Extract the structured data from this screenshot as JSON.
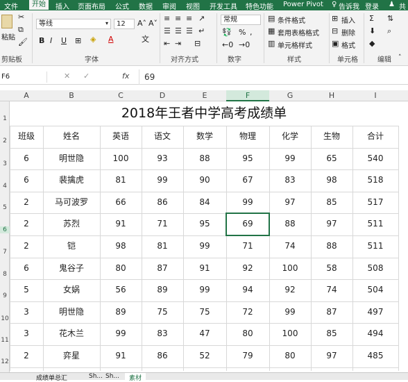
{
  "menu_tabs": [
    "文件",
    "开始",
    "插入",
    "页面布局",
    "公式",
    "数据",
    "审阅",
    "视图",
    "开发工具",
    "特色功能",
    "Power Pivot"
  ],
  "tell_me": "告诉我",
  "login": "登录",
  "share": "共",
  "ribbon": {
    "paste_label": "粘贴",
    "clipboard_label": "剪贴板",
    "font_name": "等线",
    "font_size": "12",
    "font_group_label": "字体",
    "align_group_label": "对齐方式",
    "number_format": "常规",
    "number_group_label": "数字",
    "conditional_format": "条件格式",
    "table_format": "套用表格格式",
    "cell_style": "单元格样式",
    "styles_group_label": "样式",
    "insert_label": "插入",
    "delete_label": "删除",
    "format_label": "格式",
    "cells_group_label": "单元格",
    "editing_group_label": "编辑"
  },
  "formula_bar": {
    "name_box": "F6",
    "fx": "fx",
    "value": "69"
  },
  "columns": [
    "A",
    "B",
    "C",
    "D",
    "E",
    "F",
    "G",
    "H",
    "I"
  ],
  "row_numbers": [
    "1",
    "2",
    "3",
    "4",
    "5",
    "6",
    "7",
    "8",
    "9",
    "10",
    "11",
    "12"
  ],
  "table": {
    "title": "2018年王者中学高考成绩单",
    "headers": [
      "班级",
      "姓名",
      "英语",
      "语文",
      "数学",
      "物理",
      "化学",
      "生物",
      "合计"
    ],
    "rows": [
      [
        "6",
        "明世隐",
        "100",
        "93",
        "88",
        "95",
        "99",
        "65",
        "540"
      ],
      [
        "6",
        "裴擒虎",
        "81",
        "99",
        "90",
        "67",
        "83",
        "98",
        "518"
      ],
      [
        "2",
        "马可波罗",
        "66",
        "86",
        "84",
        "99",
        "97",
        "85",
        "517"
      ],
      [
        "2",
        "苏烈",
        "91",
        "71",
        "95",
        "69",
        "88",
        "97",
        "511"
      ],
      [
        "2",
        "铠",
        "98",
        "81",
        "99",
        "71",
        "74",
        "88",
        "511"
      ],
      [
        "6",
        "鬼谷子",
        "80",
        "87",
        "91",
        "92",
        "100",
        "58",
        "508"
      ],
      [
        "5",
        "女娲",
        "56",
        "89",
        "99",
        "94",
        "92",
        "74",
        "504"
      ],
      [
        "3",
        "明世隐",
        "89",
        "75",
        "75",
        "72",
        "99",
        "87",
        "497"
      ],
      [
        "3",
        "花木兰",
        "99",
        "83",
        "47",
        "80",
        "100",
        "85",
        "494"
      ],
      [
        "2",
        "弈星",
        "91",
        "86",
        "52",
        "79",
        "80",
        "97",
        "485"
      ]
    ]
  },
  "sheet_tabs": [
    "成绩单总汇",
    "Sh...",
    "Sh...",
    "素材"
  ],
  "colors": {
    "excel_green": "#217346"
  }
}
